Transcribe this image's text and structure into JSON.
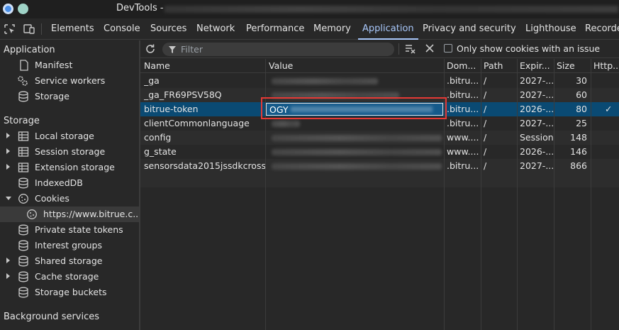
{
  "window": {
    "title": "DevTools -"
  },
  "tabs": [
    {
      "label": "Elements"
    },
    {
      "label": "Console"
    },
    {
      "label": "Sources"
    },
    {
      "label": "Network"
    },
    {
      "label": "Performance"
    },
    {
      "label": "Memory"
    },
    {
      "label": "Application",
      "active": true
    },
    {
      "label": "Privacy and security"
    },
    {
      "label": "Lighthouse"
    },
    {
      "label": "Recorder"
    }
  ],
  "sidebar": {
    "application_heading": "Application",
    "application_items": [
      {
        "label": "Manifest",
        "icon": "file-icon"
      },
      {
        "label": "Service workers",
        "icon": "gears-icon"
      },
      {
        "label": "Storage",
        "icon": "database-icon"
      }
    ],
    "storage_heading": "Storage",
    "storage_items": [
      {
        "label": "Local storage",
        "icon": "table-icon",
        "expandable": true
      },
      {
        "label": "Session storage",
        "icon": "table-icon",
        "expandable": true
      },
      {
        "label": "Extension storage",
        "icon": "table-icon",
        "expandable": true
      },
      {
        "label": "IndexedDB",
        "icon": "database-icon",
        "expandable": false
      },
      {
        "label": "Cookies",
        "icon": "cookie-icon",
        "expanded": true
      },
      {
        "label": "https://www.bitrue.c...",
        "icon": "cookie-icon",
        "child": true,
        "selected": true
      },
      {
        "label": "Private state tokens",
        "icon": "database-icon"
      },
      {
        "label": "Interest groups",
        "icon": "database-icon"
      },
      {
        "label": "Shared storage",
        "icon": "database-icon",
        "expandable": true
      },
      {
        "label": "Cache storage",
        "icon": "database-icon",
        "expandable": true
      },
      {
        "label": "Storage buckets",
        "icon": "database-icon"
      }
    ],
    "background_heading": "Background services"
  },
  "toolbar": {
    "filter_placeholder": "Filter",
    "only_issues_label": "Only show cookies with an issue",
    "only_issues_checked": false
  },
  "table": {
    "headers": {
      "name": "Name",
      "value": "Value",
      "domain": "Dom...",
      "path": "Path",
      "expires": "Expir...",
      "size": "Size",
      "http": "Http..."
    },
    "rows": [
      {
        "name": "_ga",
        "value": "",
        "domain": ".bitru...",
        "path": "/",
        "expires": "2027-...",
        "size": "30",
        "http": ""
      },
      {
        "name": "_ga_FR69PSV58Q",
        "value": "",
        "domain": ".bitru...",
        "path": "/",
        "expires": "2027-...",
        "size": "60",
        "http": ""
      },
      {
        "name": "bitrue-token",
        "value": "OGY",
        "domain": ".bitru...",
        "path": "/",
        "expires": "2026-...",
        "size": "80",
        "http": "✓",
        "selected": true
      },
      {
        "name": "clientCommonlanguage",
        "value": "",
        "domain": ".bitru...",
        "path": "/",
        "expires": "2027-...",
        "size": "25",
        "http": ""
      },
      {
        "name": "config",
        "value": "",
        "domain": "www....",
        "path": "/",
        "expires": "Session",
        "size": "148",
        "http": ""
      },
      {
        "name": "g_state",
        "value": "",
        "domain": "www....",
        "path": "/",
        "expires": "2026-...",
        "size": "146",
        "http": ""
      },
      {
        "name": "sensorsdata2015jssdkcross",
        "value": "",
        "domain": ".bitru...",
        "path": "/",
        "expires": "2027-...",
        "size": "866",
        "http": ""
      }
    ]
  },
  "colors": {
    "accent": "#a8c7fa",
    "selection": "#0a4a73",
    "highlight_border": "#e53935"
  }
}
